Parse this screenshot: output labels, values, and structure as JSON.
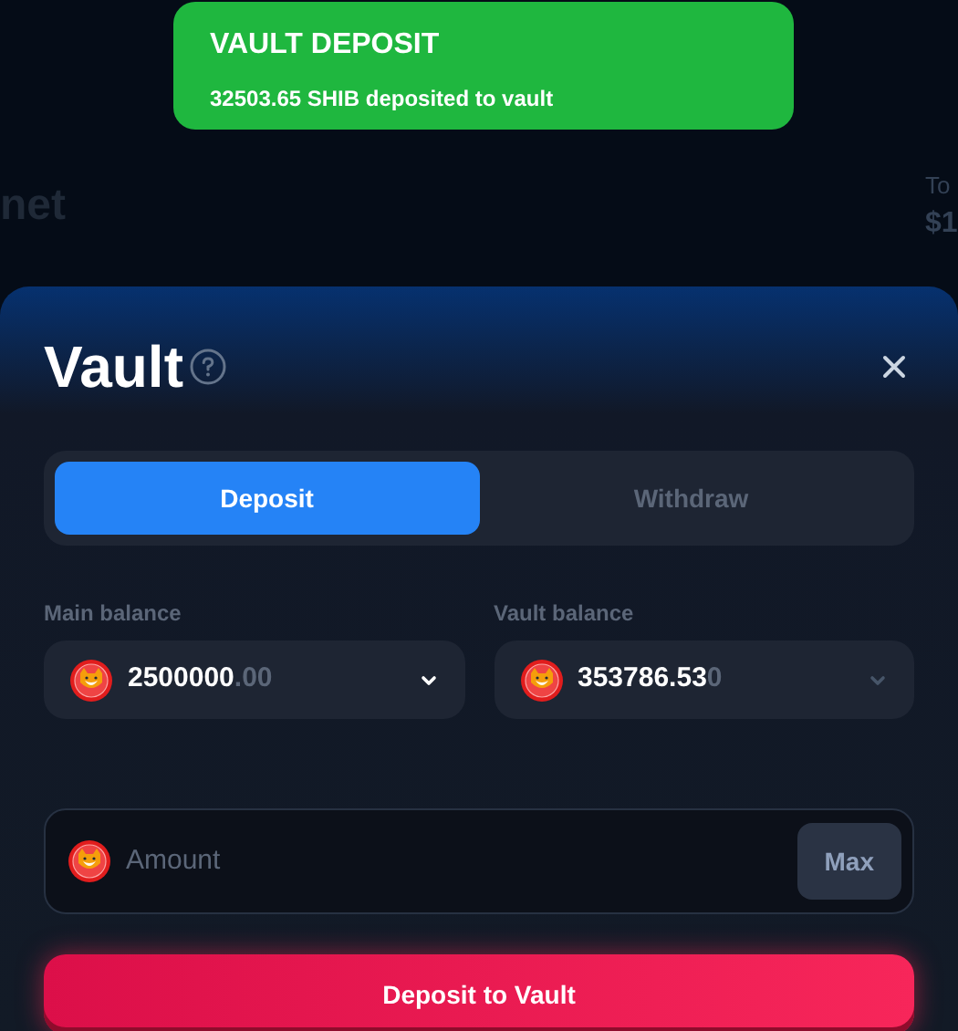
{
  "toast": {
    "title": "VAULT DEPOSIT",
    "message": "32503.65 SHIB deposited to vault"
  },
  "background": {
    "heading_fragment": "net",
    "stat_label_fragment": "To",
    "stat_value_fragment": "$1"
  },
  "modal": {
    "title": "Vault",
    "tabs": [
      {
        "label": "Deposit",
        "selected": true
      },
      {
        "label": "Withdraw",
        "selected": false
      }
    ],
    "balances": [
      {
        "label": "Main balance",
        "value": "2500000",
        "faded": ".00",
        "disabled": false
      },
      {
        "label": "Vault balance",
        "value": "353786.53",
        "faded": "0",
        "disabled": true
      }
    ],
    "amount": {
      "placeholder": "Amount",
      "max_label": "Max"
    },
    "submit": "Deposit to Vault"
  }
}
